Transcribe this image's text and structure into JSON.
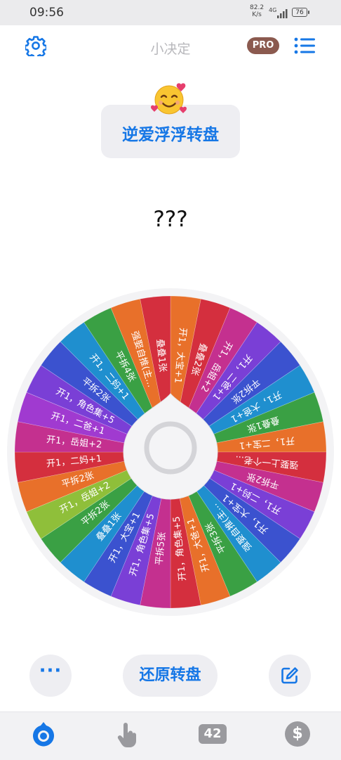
{
  "status": {
    "time": "09:56",
    "net_speed": "82.2",
    "net_unit": "K/s",
    "network": "4G",
    "battery": "76"
  },
  "header": {
    "title": "小决定",
    "pro_badge": "PRO",
    "settings_icon": "gear-icon",
    "menu_icon": "list-icon"
  },
  "wheel_title": {
    "emoji": "smiling-face-with-hearts",
    "text": "逆爱浮浮转盘"
  },
  "result_text": "???",
  "wheel": {
    "segments": [
      {
        "label": "开1，大宝+1",
        "color": "#e8702a"
      },
      {
        "label": "叠叠2张",
        "color": "#d42f3e"
      },
      {
        "label": "开1，岳姐+2",
        "color": "#c4308f"
      },
      {
        "label": "开1，二爸+1",
        "color": "#7a3fd6"
      },
      {
        "label": "平拆2张",
        "color": "#3b52cf"
      },
      {
        "label": "开1，大爸+1",
        "color": "#1f8fcf"
      },
      {
        "label": "叠叠1张",
        "color": "#3aa044"
      },
      {
        "label": "开1，二宝+1",
        "color": "#e8702a"
      },
      {
        "label": "强娶上一个老...",
        "color": "#d42f3e"
      },
      {
        "label": "平拆2张",
        "color": "#c4308f"
      },
      {
        "label": "开1，二妈+1",
        "color": "#7a3fd6"
      },
      {
        "label": "开1，大宝+1",
        "color": "#3b52cf"
      },
      {
        "label": "强娶自推(主...",
        "color": "#1f8fcf"
      },
      {
        "label": "平拆3张",
        "color": "#3aa044"
      },
      {
        "label": "开1，大爸+1",
        "color": "#e8702a"
      },
      {
        "label": "开1，角色集+5",
        "color": "#d42f3e"
      },
      {
        "label": "平拆5张",
        "color": "#c4308f"
      },
      {
        "label": "开1，角色集+5",
        "color": "#7a3fd6"
      },
      {
        "label": "开1，大宝+1",
        "color": "#3b52cf"
      },
      {
        "label": "叠叠1张",
        "color": "#1f8fcf"
      },
      {
        "label": "平拆2张",
        "color": "#3aa044"
      },
      {
        "label": "开1，岳姐+2",
        "color": "#8fbf3a"
      },
      {
        "label": "平拆2张",
        "color": "#e8702a"
      },
      {
        "label": "开1，二妈+1",
        "color": "#d42f3e"
      },
      {
        "label": "开1，岳姐+2",
        "color": "#c4308f"
      },
      {
        "label": "开1，二爸+1",
        "color": "#a03ad0"
      },
      {
        "label": "开1，角色集+5",
        "color": "#7a3fd6"
      },
      {
        "label": "平拆2张",
        "color": "#3b52cf"
      },
      {
        "label": "开1，二妈+1",
        "color": "#1f8fcf"
      },
      {
        "label": "平拆4张",
        "color": "#3aa044"
      },
      {
        "label": "强娶自推(主...",
        "color": "#e8702a"
      },
      {
        "label": "叠叠1张",
        "color": "#d42f3e"
      }
    ]
  },
  "actions": {
    "more_label": "···",
    "restore_label": "还原转盘",
    "edit_icon": "edit-icon"
  },
  "nav": {
    "wheel_icon": "wheel-icon",
    "hand_icon": "hand-pointer-icon",
    "count": "42",
    "dollar": "$"
  }
}
